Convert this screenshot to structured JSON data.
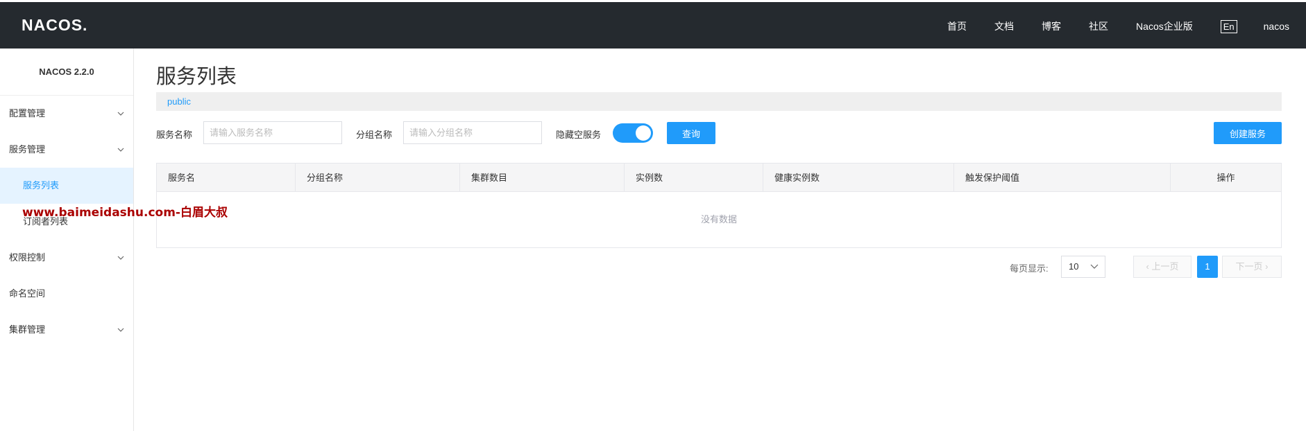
{
  "header": {
    "logo": "NACOS.",
    "nav": [
      "首页",
      "文档",
      "博客",
      "社区",
      "Nacos企业版"
    ],
    "lang": "En",
    "user": "nacos"
  },
  "sidebar": {
    "version": "NACOS 2.2.0",
    "items": [
      {
        "label": "配置管理",
        "expandable": true
      },
      {
        "label": "服务管理",
        "expandable": true
      },
      {
        "label": "服务列表",
        "sub": true,
        "active": true
      },
      {
        "label": "订阅者列表",
        "sub": true
      },
      {
        "label": "权限控制",
        "expandable": true
      },
      {
        "label": "命名空间"
      },
      {
        "label": "集群管理",
        "expandable": true
      }
    ]
  },
  "watermark": "www.baimeidashu.com-白眉大叔",
  "main": {
    "title": "服务列表",
    "namespace": "public",
    "filter": {
      "service_label": "服务名称",
      "service_placeholder": "请输入服务名称",
      "group_label": "分组名称",
      "group_placeholder": "请输入分组名称",
      "hide_empty_label": "隐藏空服务",
      "hide_empty_on": true,
      "query_button": "查询",
      "create_button": "创建服务"
    },
    "table": {
      "columns": [
        "服务名",
        "分组名称",
        "集群数目",
        "实例数",
        "健康实例数",
        "触发保护阈值",
        "操作"
      ],
      "empty_text": "没有数据"
    },
    "pagination": {
      "page_size_label": "每页显示:",
      "page_size": "10",
      "prev": "上一页",
      "next": "下一页",
      "current_page": "1"
    }
  },
  "colors": {
    "topbar": "#252a2f",
    "accent": "#209bfa",
    "watermark": "#aa0000"
  }
}
